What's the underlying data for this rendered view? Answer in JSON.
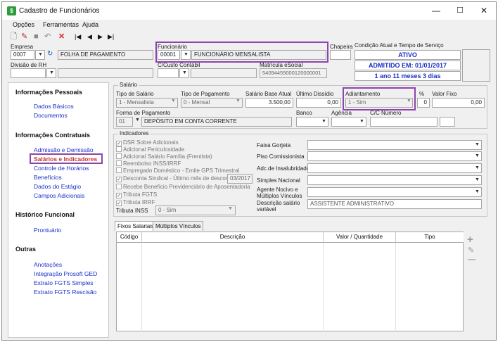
{
  "window": {
    "title": "Cadastro de Funcionários",
    "minimize": "—",
    "maximize": "☐",
    "close": "✕"
  },
  "menu": {
    "items": [
      "Opções",
      "Ferramentas",
      "Ajuda"
    ]
  },
  "labels": {
    "empresa": "Empresa",
    "funcionario": "Funcionário",
    "chapeira": "Chapeira",
    "condicao": "Condição Atual e Tempo de Serviço",
    "divisao": "Divisão de RH",
    "custo": "C/Custo Contábil",
    "matricula": "Matrícula eSocial"
  },
  "empresa": {
    "code": "0007",
    "name": "FOLHA DE PAGAMENTO"
  },
  "funcionario": {
    "code": "00001",
    "name": "FUNCIONÁRIO MENSALISTA"
  },
  "matricula": {
    "value": "54094459000120000001"
  },
  "condicao": {
    "status": "ATIVO",
    "admitido": "ADMITIDO EM: 01/01/2017",
    "tempo": "1 ano 11 meses 3 dias"
  },
  "sidebar": {
    "sec1": "Informações Pessoais",
    "dados_basicos": "Dados Básicos",
    "documentos": "Documentos",
    "sec2": "Informações Contratuais",
    "admissao": "Admissão e Demissão",
    "salarios": "Salários e Indicadores",
    "horarios": "Controle de Horários",
    "beneficios": "Benefícios",
    "estagio": "Dados do Estágio",
    "campos": "Campos Adicionais",
    "sec3": "Histórico Funcional",
    "prontuario": "Prontuário",
    "sec4": "Outras",
    "anotacoes": "Anotações",
    "prosoft": "Integração Prosoft GED",
    "extrato_simples": "Extrato FGTS Simples",
    "extrato_rescisao": "Extrato FGTS Rescisão"
  },
  "salario": {
    "group": "Salário",
    "tipo_label": "Tipo de Salário",
    "tipo_value": "1 - Mensalista",
    "pag_label": "Tipo de Pagamento",
    "pag_value": "0 - Mensal",
    "base_label": "Salário Base Atual",
    "base_value": "3.500,00",
    "dissidio_label": "Último Dissídio",
    "dissidio_value": "0,00",
    "adiant_label": "Adiantamento",
    "adiant_value": "1 - Sim",
    "pct_label": "%",
    "pct_value": "0",
    "fixo_label": "Valor Fixo",
    "fixo_value": "0,00",
    "forma_label": "Forma de Pagamento",
    "forma_code": "01",
    "forma_value": "DEPÓSITO EM CONTA CORRENTE",
    "banco_label": "Banco",
    "agencia_label": "Agência",
    "conta_label": "C/C Número"
  },
  "indicadores": {
    "group": "Indicadores",
    "checks": [
      "DSR Sobre Adicionais",
      "Adicional Periculosidade",
      "Adicional Salário Família (Frentista)",
      "Reembolso INSS/IRRF",
      "Empregado Doméstico - Emite GPS Trimestral",
      "Desconta Sindical - Último mês de desconto",
      "Recebe Benefício Previdenciário de Aposentadoria",
      "Tributa FGTS",
      "Tributa IRRF"
    ],
    "sindical_month": "03/2017",
    "inss_label": "Tributa INSS",
    "inss_value": "0 - Sim",
    "faixa": "Faixa Gorjeta",
    "piso": "Piso Comissionista",
    "insalubridade": "Adc.de Insalubridade",
    "simples": "Simples Nacional",
    "agente": "Agente Nocivo e Múltiplos Vínculos",
    "descricao_label": "Descrição salário variável",
    "descricao_value": "ASSISTENTE ADMINISTRATIVO"
  },
  "tabs": [
    "Fixos Salariais",
    "Múltiplos Vínculos"
  ],
  "grid": {
    "columns": [
      "Código",
      "Descrição",
      "Valor / Quantidade",
      "Tipo"
    ]
  },
  "actions": {
    "add": "+",
    "edit": "✎",
    "remove": "—"
  }
}
